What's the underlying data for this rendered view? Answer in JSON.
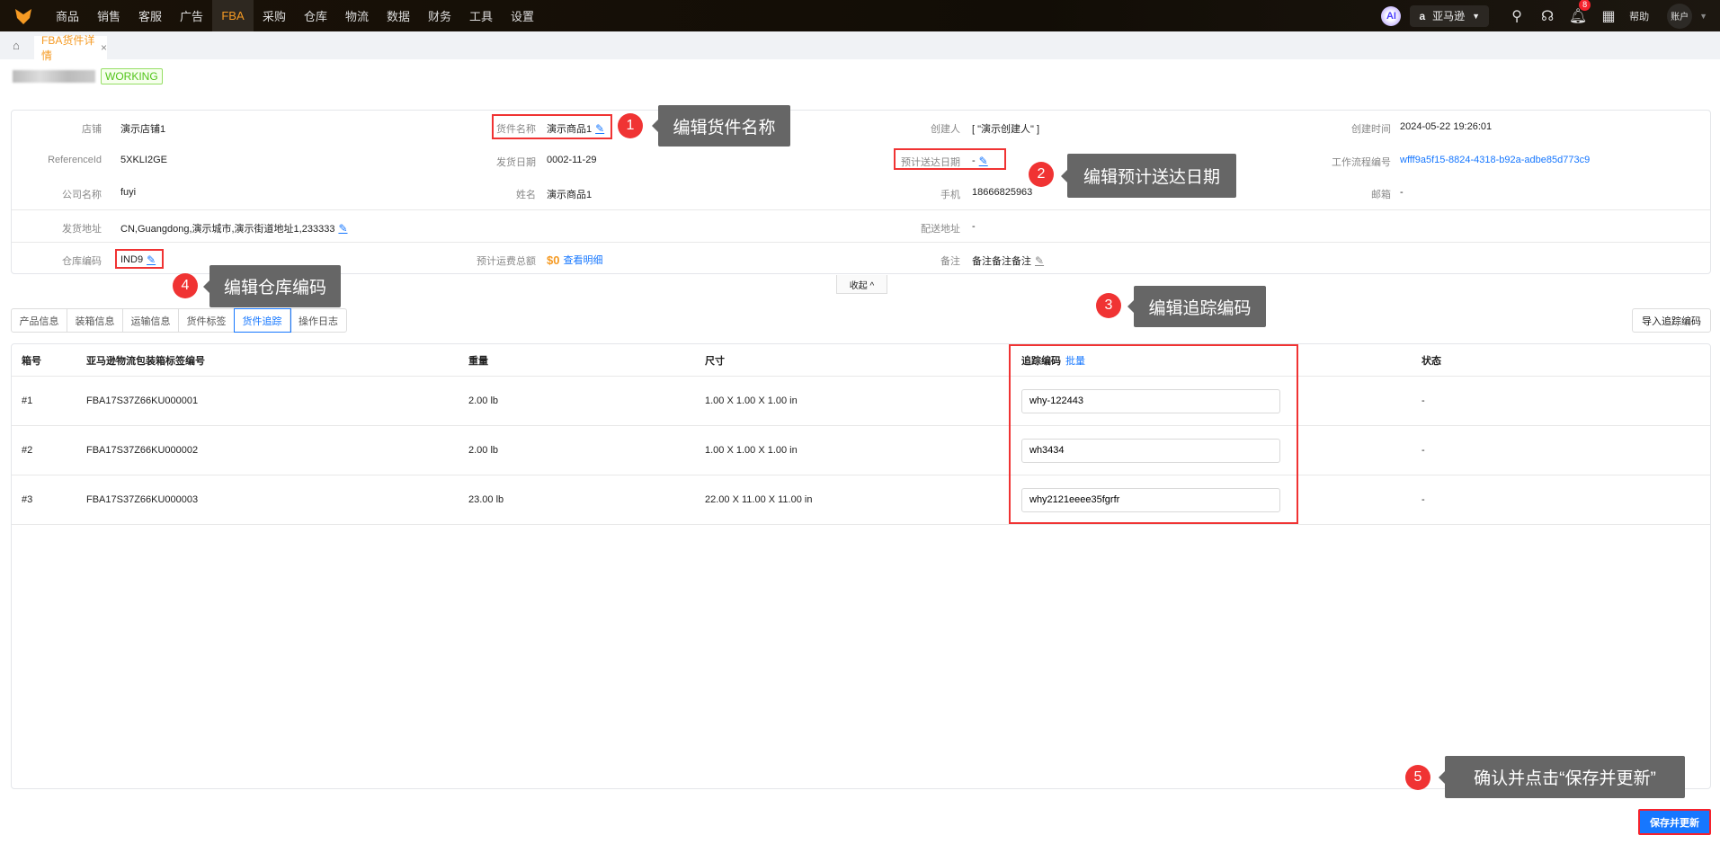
{
  "nav": {
    "items": [
      "商品",
      "销售",
      "客服",
      "广告",
      "FBA",
      "采购",
      "仓库",
      "物流",
      "数据",
      "财务",
      "工具",
      "设置"
    ],
    "active": "FBA",
    "ai": "AI",
    "store": "亚马逊",
    "notifications": "8",
    "help": "帮助",
    "account": "账户"
  },
  "page_tab": {
    "label": "FBA货件详情",
    "close": "×"
  },
  "status": "WORKING",
  "info": {
    "shop_label": "店铺",
    "shop": "演示店铺1",
    "name_label": "货件名称",
    "name": "演示商品1",
    "creator_label": "创建人",
    "creator": "[ \"演示创建人\" ]",
    "ctime_label": "创建时间",
    "ctime": "2024-05-22 19:26:01",
    "ref_label": "ReferenceId",
    "ref": "5XKLI2GE",
    "ship_date_label": "发货日期",
    "ship_date": "0002-11-29",
    "eta_label": "预计送达日期",
    "eta": "-",
    "wf_label": "工作流程编号",
    "wf": "wfff9a5f15-8824-4318-b92a-adbe85d773c9",
    "company_label": "公司名称",
    "company": "fuyi",
    "person_label": "姓名",
    "person": "演示商品1",
    "phone_label": "手机",
    "phone": "18666825963",
    "email_label": "邮箱",
    "email": "-",
    "from_label": "发货地址",
    "from": "CN,Guangdong,演示城市,演示街道地址1,233333",
    "to_label": "配送地址",
    "to": "-",
    "wh_label": "仓库编码",
    "wh": "IND9",
    "fee_label": "预计运费总额",
    "fee": "$0",
    "fee_link": "查看明细",
    "note_label": "备注",
    "note": "备注备注备注"
  },
  "collapse": "收起 ^",
  "tabs": [
    "产品信息",
    "装箱信息",
    "运输信息",
    "货件标签",
    "货件追踪",
    "操作日志"
  ],
  "import_button": "导入追踪编码",
  "table": {
    "headers": {
      "box": "箱号",
      "label": "亚马逊物流包装箱标签编号",
      "weight": "重量",
      "size": "尺寸",
      "tracking": "追踪编码",
      "batch": "批量",
      "status": "状态"
    },
    "rows": [
      {
        "box": "#1",
        "label": "FBA17S37Z66KU000001",
        "weight": "2.00 lb",
        "size": "1.00 X 1.00 X 1.00 in",
        "tracking": "why-122443",
        "status": "-"
      },
      {
        "box": "#2",
        "label": "FBA17S37Z66KU000002",
        "weight": "2.00 lb",
        "size": "1.00 X 1.00 X 1.00 in",
        "tracking": "wh3434",
        "status": "-"
      },
      {
        "box": "#3",
        "label": "FBA17S37Z66KU000003",
        "weight": "23.00 lb",
        "size": "22.00 X 11.00 X 11.00 in",
        "tracking": "why2121eeee35fgrfr",
        "status": "-"
      }
    ]
  },
  "save_button": "保存并更新",
  "annotations": [
    {
      "n": "1",
      "text": "编辑货件名称"
    },
    {
      "n": "2",
      "text": "编辑预计送达日期"
    },
    {
      "n": "3",
      "text": "编辑追踪编码"
    },
    {
      "n": "4",
      "text": "编辑仓库编码"
    },
    {
      "n": "5",
      "text": "确认并点击“保存并更新”"
    }
  ]
}
